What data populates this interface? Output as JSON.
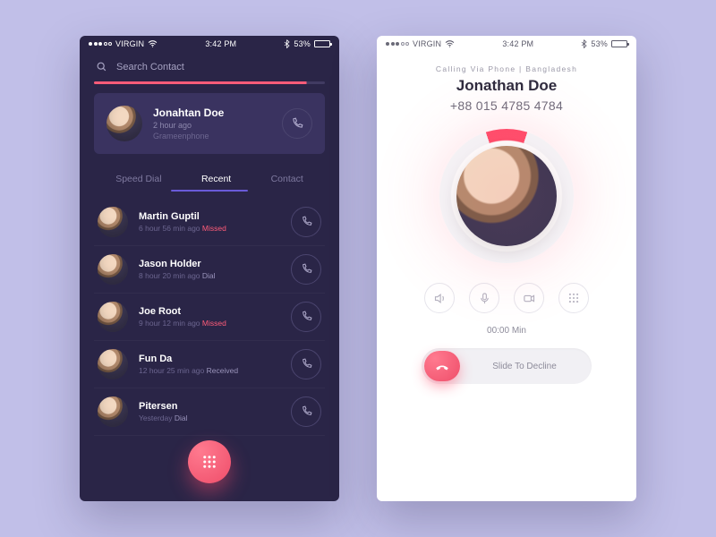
{
  "status": {
    "carrier": "VIRGIN",
    "time": "3:42 PM",
    "battery": "53%"
  },
  "dark": {
    "search_placeholder": "Search Contact",
    "featured": {
      "name": "Jonahtan Doe",
      "time": "2 hour ago",
      "carrier": "Grameenphone"
    },
    "tabs": {
      "speed": "Speed Dial",
      "recent": "Recent",
      "contact": "Contact"
    },
    "rows": [
      {
        "name": "Martin Guptil",
        "time": "6 hour 56 min ago",
        "status": "Missed",
        "cls": "miss"
      },
      {
        "name": "Jason Holder",
        "time": "8 hour 20 min ago",
        "status": "Dial",
        "cls": "dial"
      },
      {
        "name": "Joe Root",
        "time": "9 hour 12 min ago",
        "status": "Missed",
        "cls": "miss"
      },
      {
        "name": "Fun Da",
        "time": "12 hour 25 min ago",
        "status": "Received",
        "cls": "recv"
      },
      {
        "name": "Pitersen",
        "time": "Yesterday",
        "status": "Dial",
        "cls": "dial"
      }
    ]
  },
  "light": {
    "via": "Calling Via Phone | Bangladesh",
    "name": "Jonathan Doe",
    "number": "+88 015 4785 4784",
    "timer": "00:00 Min",
    "slide": "Slide To Decline"
  }
}
